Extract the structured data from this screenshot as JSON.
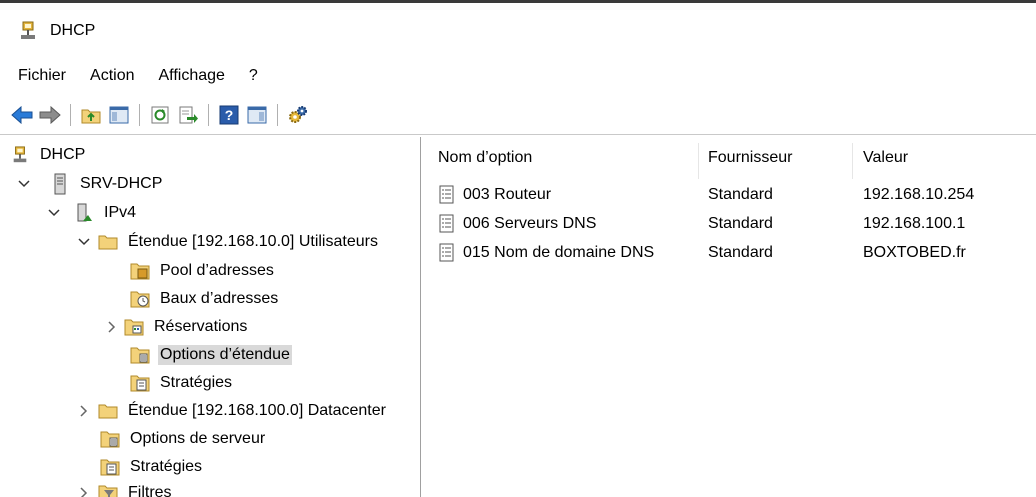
{
  "window": {
    "title": "DHCP"
  },
  "menu": {
    "items": [
      "Fichier",
      "Action",
      "Affichage",
      "?"
    ]
  },
  "tree": {
    "root": "DHCP",
    "server": "SRV-DHCP",
    "ipv4": "IPv4",
    "scope1": "Étendue [192.168.10.0] Utilisateurs",
    "pool": "Pool d’adresses",
    "leases": "Baux d’adresses",
    "reservations": "Réservations",
    "scope_options": "Options d’étendue",
    "scope_policies": "Stratégies",
    "scope2": "Étendue [192.168.100.0] Datacenter",
    "server_options": "Options de serveur",
    "policies": "Stratégies",
    "filters": "Filtres"
  },
  "table": {
    "columns": [
      "Nom d’option",
      "Fournisseur",
      "Valeur"
    ],
    "rows": [
      {
        "name": "003 Routeur",
        "vendor": "Standard",
        "value": "192.168.10.254"
      },
      {
        "name": "006 Serveurs DNS",
        "vendor": "Standard",
        "value": "192.168.100.1"
      },
      {
        "name": "015 Nom de domaine DNS",
        "vendor": "Standard",
        "value": "BOXTOBED.fr"
      }
    ]
  },
  "colors": {
    "selection": "#d9d9d9",
    "folder": "#f3d27a",
    "arrow_blue": "#2a7bd8"
  }
}
